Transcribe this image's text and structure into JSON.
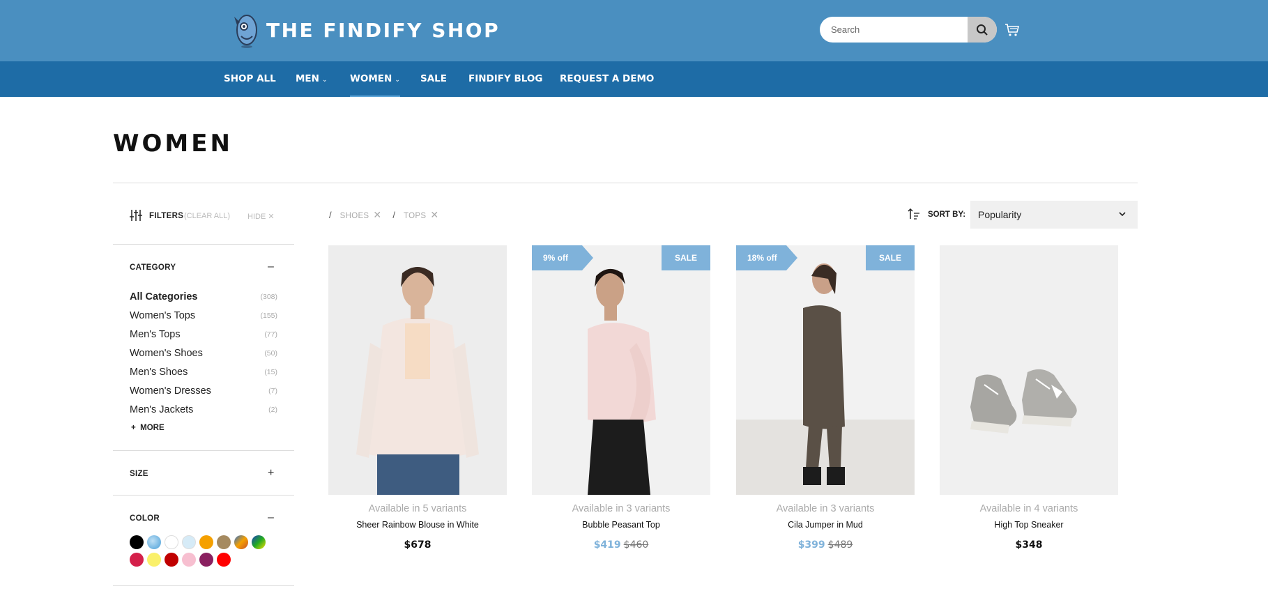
{
  "header": {
    "brand": "THE FINDIFY SHOP",
    "search_placeholder": "Search",
    "icons": {
      "logo": "owl-logo-icon",
      "search": "search-icon",
      "cart": "cart-icon"
    }
  },
  "nav": {
    "items": [
      {
        "label": "SHOP ALL"
      },
      {
        "label": "MEN",
        "dropdown": true
      },
      {
        "label": "WOMEN",
        "dropdown": true,
        "active": true
      },
      {
        "label": "SALE"
      },
      {
        "label": "FINDIFY BLOG"
      },
      {
        "label": "REQUEST A DEMO"
      }
    ]
  },
  "page": {
    "title": "WOMEN"
  },
  "filters": {
    "label": "FILTERS",
    "clear_all": "(CLEAR ALL)",
    "hide": "HIDE",
    "category": {
      "title": "CATEGORY",
      "toggle": "–",
      "items": [
        {
          "name": "All Categories",
          "count": "(308)"
        },
        {
          "name": "Women's Tops",
          "count": "(155)"
        },
        {
          "name": "Men's Tops",
          "count": "(77)"
        },
        {
          "name": "Women's Shoes",
          "count": "(50)"
        },
        {
          "name": "Men's Shoes",
          "count": "(15)"
        },
        {
          "name": "Women's Dresses",
          "count": "(7)"
        },
        {
          "name": "Men's Jackets",
          "count": "(2)"
        }
      ],
      "more": "MORE"
    },
    "size": {
      "title": "SIZE",
      "toggle": "+"
    },
    "color": {
      "title": "COLOR",
      "toggle": "–",
      "swatches": [
        "#000000",
        "#4a9fd8",
        "#ffffff",
        "#d6ebf7",
        "#f5a000",
        "#a58a60",
        "#c8502a",
        "#22aa22",
        "#d4204a",
        "#faf06a",
        "#c00000",
        "#f7bfd0",
        "#8a2060",
        "#ff0000"
      ]
    }
  },
  "active_filters": {
    "separator": "/",
    "chips": [
      {
        "label": "SHOES"
      },
      {
        "label": "TOPS"
      }
    ]
  },
  "sort": {
    "label": "SORT BY:",
    "value": "Popularity"
  },
  "products": [
    {
      "name": "Sheer Rainbow Blouse in White",
      "variants": "Available in 5 variants",
      "price": "$678",
      "old_price": "",
      "discount": "",
      "sale_badge": ""
    },
    {
      "name": "Bubble Peasant Top",
      "variants": "Available in 3 variants",
      "price": "$419",
      "old_price": "$460",
      "discount": "9% off",
      "sale_badge": "SALE"
    },
    {
      "name": "Cila Jumper in Mud",
      "variants": "Available in 3 variants",
      "price": "$399",
      "old_price": "$489",
      "discount": "18% off",
      "sale_badge": "SALE"
    },
    {
      "name": "High Top Sneaker",
      "variants": "Available in 4 variants",
      "price": "$348",
      "old_price": "",
      "discount": "",
      "sale_badge": ""
    }
  ],
  "colors": {
    "topbar": "#4a8fc0",
    "navbar": "#1e6ca6",
    "sale_accent": "#7fb2da"
  }
}
